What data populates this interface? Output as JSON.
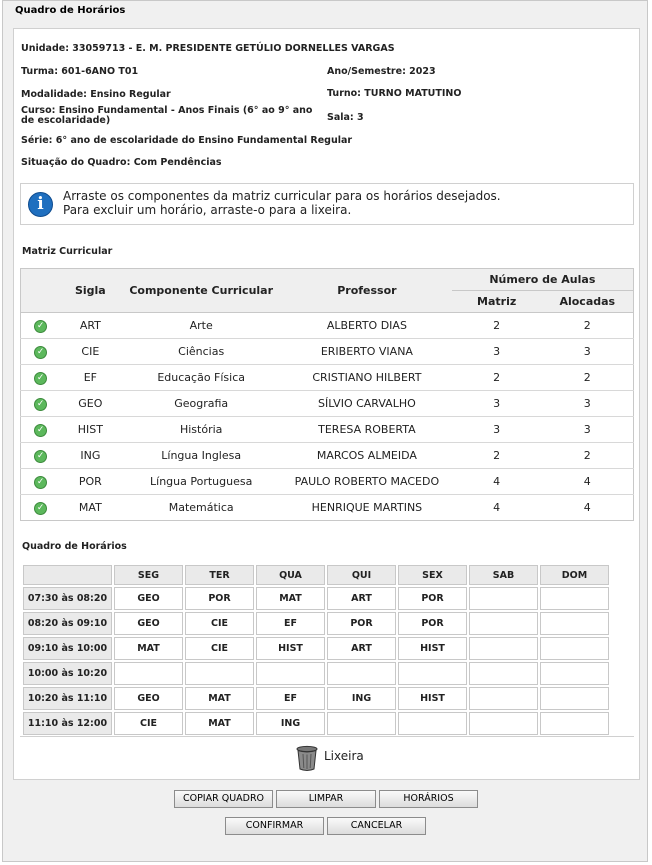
{
  "window": {
    "title": "Quadro de Horários"
  },
  "info": {
    "unidade": "Unidade: 33059713 - E. M. PRESIDENTE GETÚLIO DORNELLES VARGAS",
    "turma": "Turma: 601-6ANO T01",
    "ano_semestre": "Ano/Semestre: 2023",
    "modalidade": "Modalidade: Ensino Regular",
    "turno": "Turno: TURNO MATUTINO",
    "curso": "Curso: Ensino Fundamental - Anos Finais (6° ao 9° ano de escolaridade)",
    "sala": "Sala: 3",
    "serie": "Série: 6° ano de escolaridade do Ensino Fundamental Regular",
    "situacao": "Situação do Quadro: Com Pendências"
  },
  "notice": {
    "line1": "Arraste os componentes da matriz curricular para os horários desejados.",
    "line2": "Para excluir um horário, arraste-o para a lixeira."
  },
  "matriz": {
    "title": "Matriz Curricular",
    "headers": {
      "sigla": "Sigla",
      "componente": "Componente Curricular",
      "professor": "Professor",
      "numero_aulas": "Número de Aulas",
      "matriz": "Matriz",
      "alocadas": "Alocadas"
    },
    "rows": [
      {
        "sigla": "ART",
        "componente": "Arte",
        "professor": "ALBERTO DIAS",
        "matriz": "2",
        "alocadas": "2"
      },
      {
        "sigla": "CIE",
        "componente": "Ciências",
        "professor": "ERIBERTO VIANA",
        "matriz": "3",
        "alocadas": "3"
      },
      {
        "sigla": "EF",
        "componente": "Educação Física",
        "professor": "CRISTIANO HILBERT",
        "matriz": "2",
        "alocadas": "2"
      },
      {
        "sigla": "GEO",
        "componente": "Geografia",
        "professor": "SÍLVIO CARVALHO",
        "matriz": "3",
        "alocadas": "3"
      },
      {
        "sigla": "HIST",
        "componente": "História",
        "professor": "TERESA ROBERTA",
        "matriz": "3",
        "alocadas": "3"
      },
      {
        "sigla": "ING",
        "componente": "Língua Inglesa",
        "professor": "MARCOS ALMEIDA",
        "matriz": "2",
        "alocadas": "2"
      },
      {
        "sigla": "POR",
        "componente": "Língua Portuguesa",
        "professor": "PAULO ROBERTO MACEDO",
        "matriz": "4",
        "alocadas": "4"
      },
      {
        "sigla": "MAT",
        "componente": "Matemática",
        "professor": "HENRIQUE MARTINS",
        "matriz": "4",
        "alocadas": "4"
      }
    ]
  },
  "horarios": {
    "title": "Quadro de Horários",
    "days": [
      "SEG",
      "TER",
      "QUA",
      "QUI",
      "SEX",
      "SAB",
      "DOM"
    ],
    "rows": [
      {
        "time": "07:30 às 08:20",
        "cells": [
          "GEO",
          "POR",
          "MAT",
          "ART",
          "POR",
          "",
          ""
        ]
      },
      {
        "time": "08:20 às 09:10",
        "cells": [
          "GEO",
          "CIE",
          "EF",
          "POR",
          "POR",
          "",
          ""
        ]
      },
      {
        "time": "09:10 às 10:00",
        "cells": [
          "MAT",
          "CIE",
          "HIST",
          "ART",
          "HIST",
          "",
          ""
        ]
      },
      {
        "time": "10:00 às 10:20",
        "cells": [
          "",
          "",
          "",
          "",
          "",
          "",
          ""
        ]
      },
      {
        "time": "10:20 às 11:10",
        "cells": [
          "GEO",
          "MAT",
          "EF",
          "ING",
          "HIST",
          "",
          ""
        ]
      },
      {
        "time": "11:10 às 12:00",
        "cells": [
          "CIE",
          "MAT",
          "ING",
          "",
          "",
          "",
          ""
        ]
      }
    ]
  },
  "lixeira": {
    "label": "Lixeira"
  },
  "buttons": {
    "copiar": "COPIAR QUADRO",
    "limpar": "LIMPAR",
    "horarios": "HORÁRIOS",
    "confirmar": "CONFIRMAR",
    "cancelar": "CANCELAR"
  }
}
